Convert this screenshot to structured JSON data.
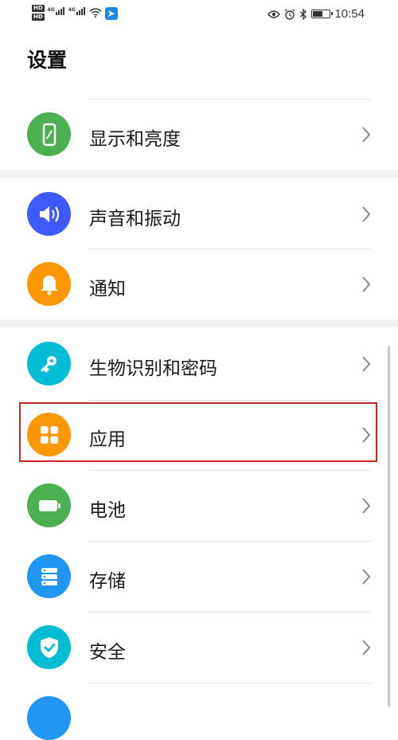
{
  "status_bar": {
    "time": "10:54",
    "left_badges": [
      "HD",
      "HD"
    ],
    "network_labels": [
      "4G",
      "4G"
    ],
    "icons": [
      "eye-comfort-icon",
      "alarm-icon",
      "bluetooth-icon",
      "battery-icon"
    ],
    "battery_level": 0.6
  },
  "page": {
    "title": "设置"
  },
  "settings_items": [
    {
      "label": "显示和亮度",
      "icon": "display-icon",
      "color": "#4caf50"
    },
    {
      "label": "声音和振动",
      "icon": "volume-icon",
      "color": "#3d5afe"
    },
    {
      "label": "通知",
      "icon": "bell-icon",
      "color": "#ff9800"
    },
    {
      "label": "生物识别和密码",
      "icon": "key-icon",
      "color": "#00bcd4"
    },
    {
      "label": "应用",
      "icon": "apps-grid-icon",
      "color": "#ff9800"
    },
    {
      "label": "电池",
      "icon": "battery-icon",
      "color": "#4caf50"
    },
    {
      "label": "存储",
      "icon": "storage-icon",
      "color": "#2196f3"
    },
    {
      "label": "安全",
      "icon": "shield-icon",
      "color": "#00bcd4"
    }
  ],
  "highlighted_item": "应用"
}
